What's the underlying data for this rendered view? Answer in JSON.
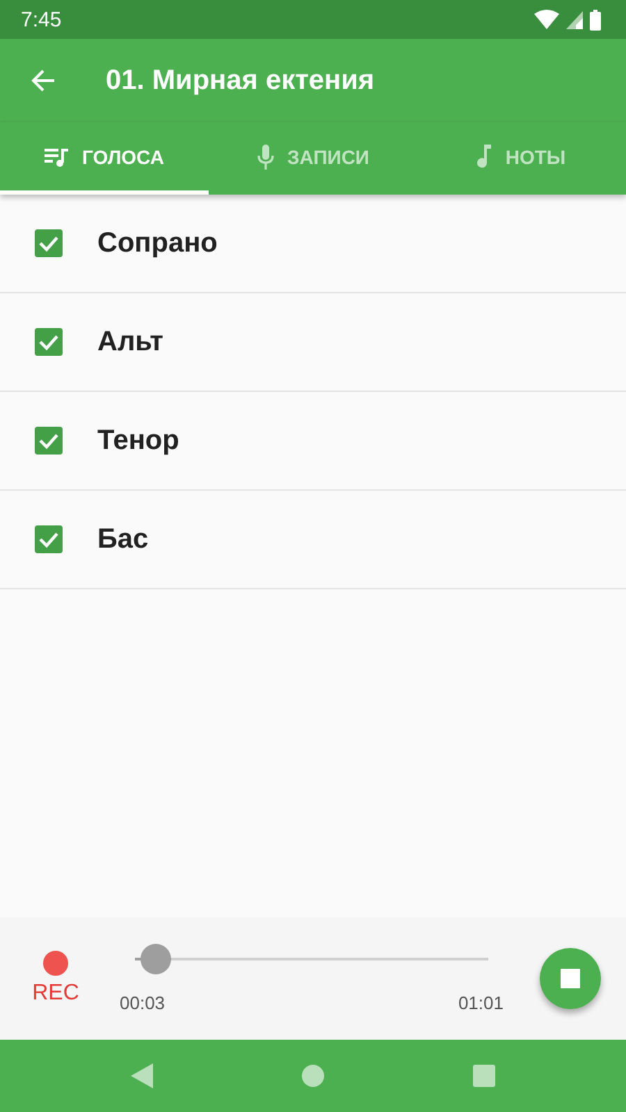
{
  "status_bar": {
    "time": "7:45"
  },
  "app_bar": {
    "title": "01. Мирная ектения"
  },
  "tabs": [
    {
      "label": "ГОЛОСА",
      "kind": "voices",
      "selected": true
    },
    {
      "label": "ЗАПИСИ",
      "kind": "mic",
      "selected": false
    },
    {
      "label": "НОТЫ",
      "kind": "note",
      "selected": false
    }
  ],
  "voices": [
    {
      "name": "Сопрано",
      "checked": true
    },
    {
      "name": "Альт",
      "checked": true
    },
    {
      "name": "Тенор",
      "checked": true
    },
    {
      "name": "Бас",
      "checked": true
    }
  ],
  "player": {
    "rec_label": "REC",
    "level": 0.06,
    "elapsed": "00:03",
    "total": "01:01"
  }
}
